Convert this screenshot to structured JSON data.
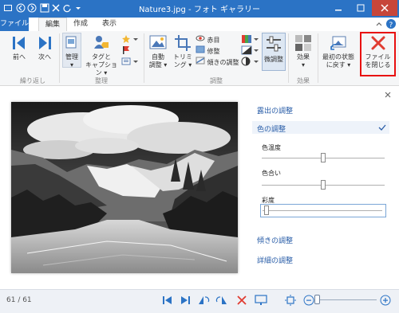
{
  "window": {
    "title": "Nature3.jpg - フォト ギャラリー"
  },
  "tabs": [
    {
      "label": "ファイル"
    },
    {
      "label": "編集"
    },
    {
      "label": "作成"
    },
    {
      "label": "表示"
    }
  ],
  "ribbon": {
    "nav": {
      "prev": "前へ",
      "next": "次へ",
      "group": "繰り返し"
    },
    "organize": {
      "manage": "管理",
      "tag1": "タグと",
      "tag2": "キャプション",
      "group": "整理"
    },
    "adjust": {
      "auto1": "自動",
      "auto2": "調整",
      "trim1": "トリミ",
      "trim2": "ング",
      "redeye": "赤目",
      "retouch": "修整",
      "straighten": "傾きの調整",
      "fine": "微調整",
      "group": "調整"
    },
    "effects": {
      "label": "効果",
      "group": "効果"
    },
    "revert": {
      "l1": "最初の状態",
      "l2": "に戻す"
    },
    "close": {
      "l1": "ファイル",
      "l2": "を閉じる"
    }
  },
  "panel": {
    "exposure": "露出の調整",
    "color": "色の調整",
    "temperature": "色温度",
    "tint": "色合い",
    "saturation": "彩度",
    "straighten": "傾きの調整",
    "detail": "詳細の調整",
    "temperature_value": 0.5,
    "tint_value": 0.5,
    "saturation_value": 0.0
  },
  "status": {
    "counter": "61 / 61"
  },
  "colors": {
    "accent": "#2b73c5",
    "highlight": "#e81010"
  }
}
